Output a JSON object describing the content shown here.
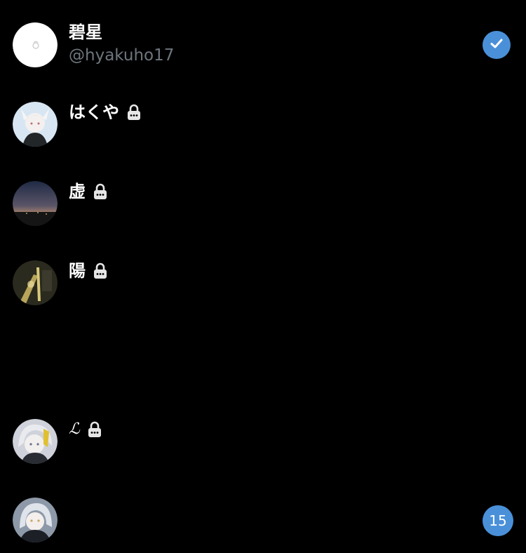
{
  "accounts": [
    {
      "name": "碧星",
      "handle": "@hyakuho17",
      "locked": false,
      "selected": true
    },
    {
      "name": "はくや",
      "handle": "",
      "locked": true,
      "selected": false
    },
    {
      "name": "虚",
      "handle": "",
      "locked": true,
      "selected": false
    },
    {
      "name": "陽",
      "handle": "",
      "locked": true,
      "selected": false
    },
    {
      "name": "ℒ",
      "handle": "",
      "locked": true,
      "selected": false
    },
    {
      "name": "",
      "handle": "",
      "locked": false,
      "selected": false,
      "badge": "15"
    }
  ],
  "colors": {
    "background": "#000000",
    "accent": "#4a90d9",
    "handle_text": "#6e767d"
  },
  "icons": {
    "lock": "lock-icon",
    "check": "checkmark-icon"
  }
}
